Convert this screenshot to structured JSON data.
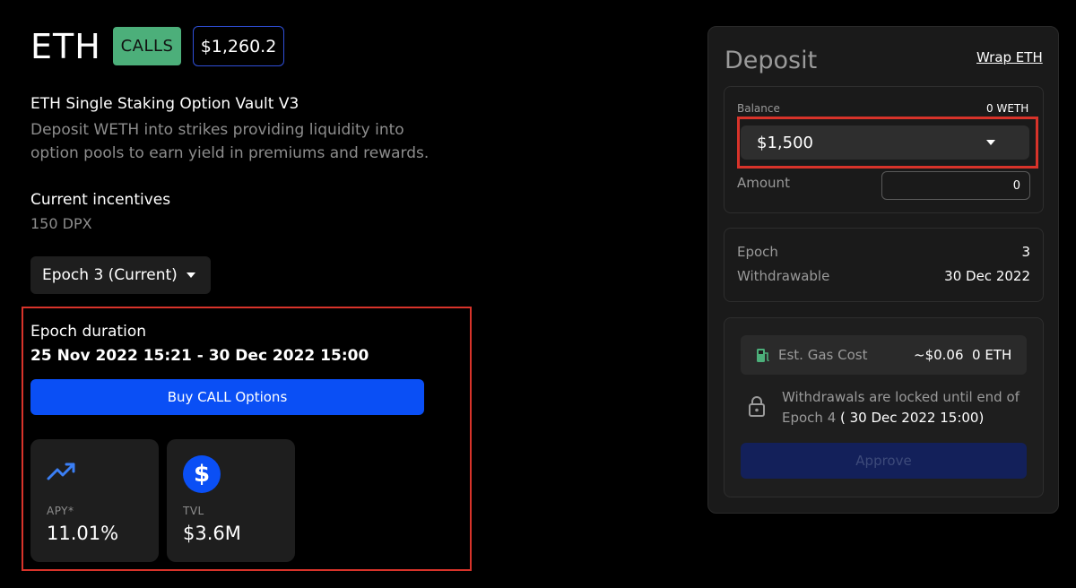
{
  "header": {
    "asset": "ETH",
    "type_badge": "CALLS",
    "price_badge": "$1,260.2",
    "type_badge_color": "#4caf7a",
    "price_border_color": "#2f4fd8"
  },
  "vault": {
    "title": "ETH Single Staking Option Vault V3",
    "description": "Deposit WETH into strikes providing liquidity into option pools to earn yield in premiums and rewards."
  },
  "incentives": {
    "label": "Current incentives",
    "value": "150 DPX"
  },
  "epoch_selector": {
    "selected": "Epoch 3 (Current)",
    "icon": "chevron-down-icon"
  },
  "epoch_duration": {
    "label": "Epoch duration",
    "value": "25 Nov 2022 15:21 - 30 Dec 2022 15:00"
  },
  "buy_button": {
    "label": "Buy CALL Options",
    "color": "#0a4ff5"
  },
  "stats": [
    {
      "label": "APY*",
      "value": "11.01%",
      "icon": "trending-up-icon"
    },
    {
      "label": "TVL",
      "value": "$3.6M",
      "icon": "dollar-icon",
      "icon_glyph": "$"
    }
  ],
  "deposit": {
    "title": "Deposit",
    "wrap_link": "Wrap ETH",
    "balance_label": "Balance",
    "balance_value": "0 WETH",
    "strike_selected": "$1,500",
    "amount_label": "Amount",
    "amount_value": "0",
    "epoch_label": "Epoch",
    "epoch_value": "3",
    "withdrawable_label": "Withdrawable",
    "withdrawable_value": "30 Dec 2022",
    "gas_label": "Est. Gas Cost",
    "gas_value": "~$0.06  0 ETH",
    "lock_text": "Withdrawals are locked until end of Epoch 4",
    "lock_date": " ( 30 Dec 2022 15:00)",
    "approve_label": "Approve"
  },
  "colors": {
    "highlight": "#d8332a",
    "accent_blue": "#0a4ff5",
    "gas_icon_green": "#4caf7a"
  }
}
